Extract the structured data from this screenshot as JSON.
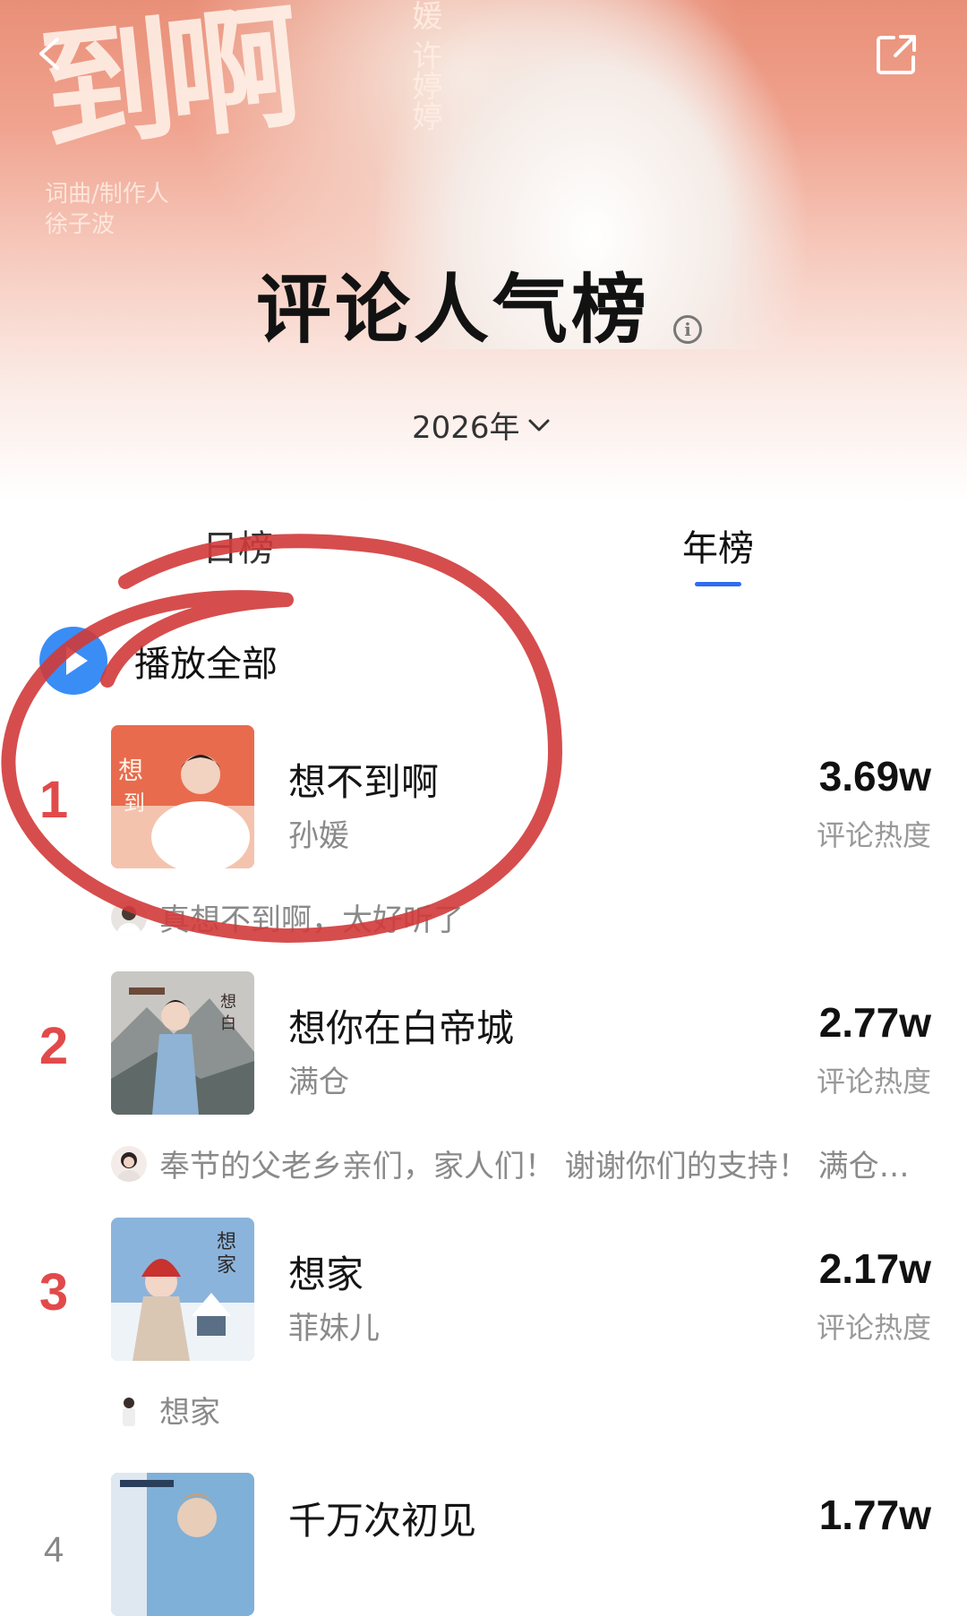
{
  "hero": {
    "calligraphy": "到啊",
    "credit_line1": "词曲/制作人",
    "credit_line2": "徐子波",
    "vertical_text": "媛 许婷婷"
  },
  "page": {
    "title": "评论人气榜",
    "year_label": "2026年"
  },
  "tabs": [
    {
      "label": "日榜",
      "active": false
    },
    {
      "label": "年榜",
      "active": true
    }
  ],
  "play_all_label": "播放全部",
  "songs": [
    {
      "rank": "1",
      "title": "想不到啊",
      "artist": "孙媛",
      "score": "3.69w",
      "score_label": "评论热度",
      "comment": "真想不到啊，太好听了"
    },
    {
      "rank": "2",
      "title": "想你在白帝城",
      "artist": "满仓",
      "score": "2.77w",
      "score_label": "评论热度",
      "comment": "奉节的父老乡亲们，家人们！ 谢谢你们的支持！ 满仓…"
    },
    {
      "rank": "3",
      "title": "想家",
      "artist": "菲妹儿",
      "score": "2.17w",
      "score_label": "评论热度",
      "comment": "想家"
    },
    {
      "rank": "4",
      "title": "千万次初见",
      "artist": "",
      "score": "1.77w",
      "score_label": "",
      "comment": ""
    }
  ],
  "colors": {
    "accent_blue": "#2f6cf0",
    "rank_red": "#e24a4a",
    "annotation_red": "#d23a3a"
  }
}
